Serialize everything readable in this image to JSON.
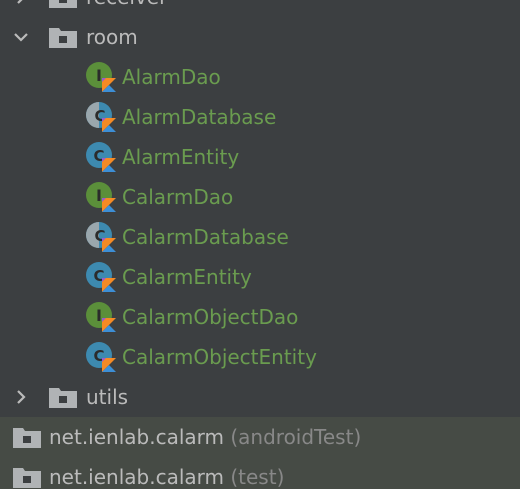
{
  "tree": {
    "receiver": {
      "label": "receiver",
      "expanded": false,
      "icon": "package-folder-icon"
    },
    "room": {
      "label": "room",
      "expanded": true,
      "icon": "package-folder-icon",
      "children": [
        {
          "label": "AlarmDao",
          "kind": "interface",
          "icon": "kotlin-interface-icon"
        },
        {
          "label": "AlarmDatabase",
          "kind": "abstract-class",
          "icon": "kotlin-abstract-class-icon"
        },
        {
          "label": "AlarmEntity",
          "kind": "class",
          "icon": "kotlin-class-icon"
        },
        {
          "label": "CalarmDao",
          "kind": "interface",
          "icon": "kotlin-interface-icon"
        },
        {
          "label": "CalarmDatabase",
          "kind": "abstract-class",
          "icon": "kotlin-abstract-class-icon"
        },
        {
          "label": "CalarmEntity",
          "kind": "class",
          "icon": "kotlin-class-icon"
        },
        {
          "label": "CalarmObjectDao",
          "kind": "interface",
          "icon": "kotlin-interface-icon"
        },
        {
          "label": "CalarmObjectEntity",
          "kind": "class",
          "icon": "kotlin-class-icon"
        }
      ]
    },
    "utils": {
      "label": "utils",
      "expanded": false,
      "icon": "package-folder-icon"
    },
    "source_sets": [
      {
        "package": "net.ienlab.calarm",
        "qualifier": "(androidTest)",
        "icon": "package-folder-icon"
      },
      {
        "package": "net.ienlab.calarm",
        "qualifier": "(test)",
        "icon": "package-folder-icon"
      }
    ]
  },
  "colors": {
    "background": "#3c3f41",
    "source_set_background": "#464b45",
    "class_label": "#6a9c4f",
    "text": "#bbbbbb",
    "muted_text": "#888888",
    "folder": "#b0b3b5",
    "interface_icon_bg": "#5b8f3a",
    "class_icon_bg": "#3d8ab0",
    "kotlin_orange": "#f58a25",
    "kotlin_blue": "#3d8fd6"
  }
}
